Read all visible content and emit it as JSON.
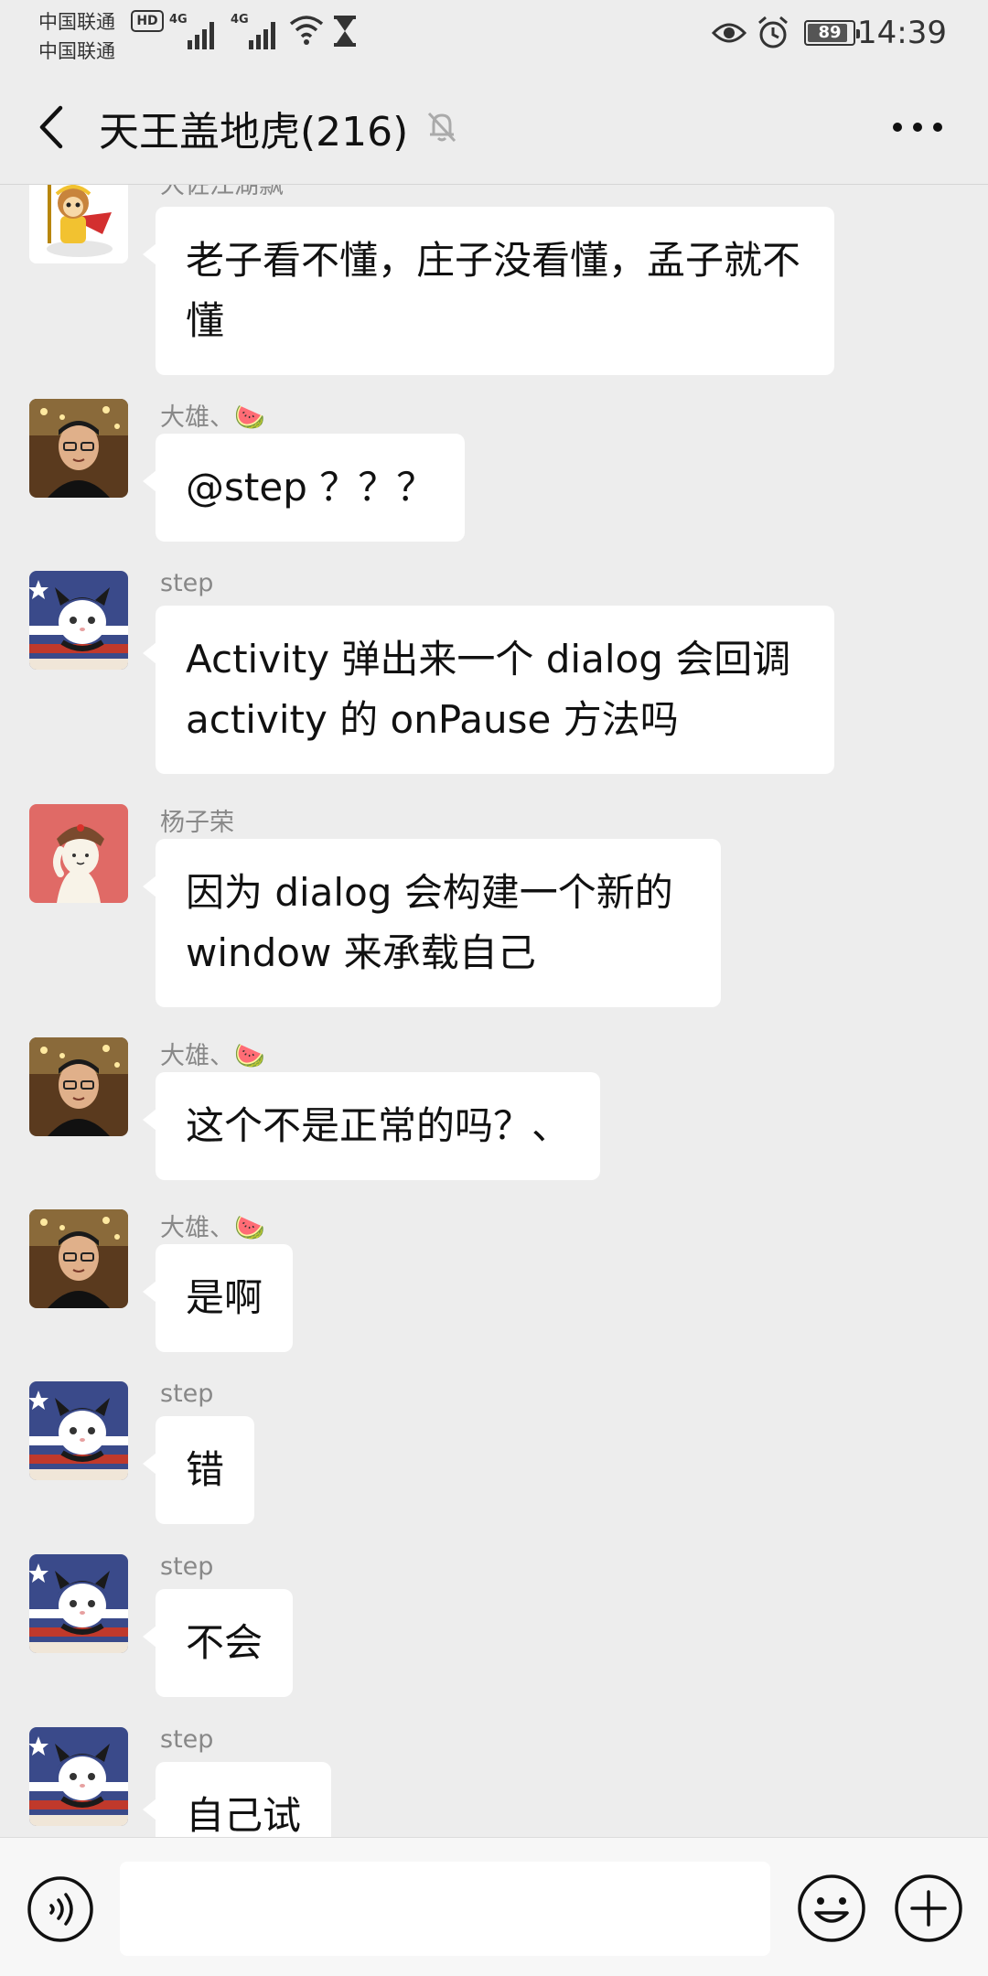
{
  "status_bar": {
    "carrier_1": "中国联通",
    "carrier_2": "中国联通",
    "hd_badge": "HD",
    "network_1": "4G",
    "network_2": "4G",
    "battery": "89",
    "time": "14:39"
  },
  "header": {
    "title": "天王盖地虎(216)"
  },
  "messages": [
    {
      "sender": "大佐江湖飘",
      "text": "老子看不懂，庄子没看懂，孟子就不懂"
    },
    {
      "sender": "大雄、🍉",
      "text": "@step ？？？"
    },
    {
      "sender": "step",
      "text": "Activity 弹出来一个 dialog 会回调 activity 的 onPause 方法吗"
    },
    {
      "sender": "杨子荣",
      "text": "因为 dialog 会构建一个新的 window 来承载自己"
    },
    {
      "sender": "大雄、🍉",
      "text": "这个不是正常的吗？、"
    },
    {
      "sender": "大雄、🍉",
      "text": "是啊"
    },
    {
      "sender": "step",
      "text": "错"
    },
    {
      "sender": "step",
      "text": "不会"
    },
    {
      "sender": "step",
      "text": "自己试"
    }
  ],
  "input": {
    "value": ""
  },
  "icons": {
    "back": "back-arrow-icon",
    "mute": "bell-muted-icon",
    "more": "more-dots-icon",
    "voice": "voice-icon",
    "emoji": "emoji-icon",
    "plus": "plus-icon"
  },
  "colors": {
    "background": "#ededed",
    "bubble": "#ffffff",
    "sender_text": "#888888",
    "bottom_bar": "#f7f7f7"
  }
}
